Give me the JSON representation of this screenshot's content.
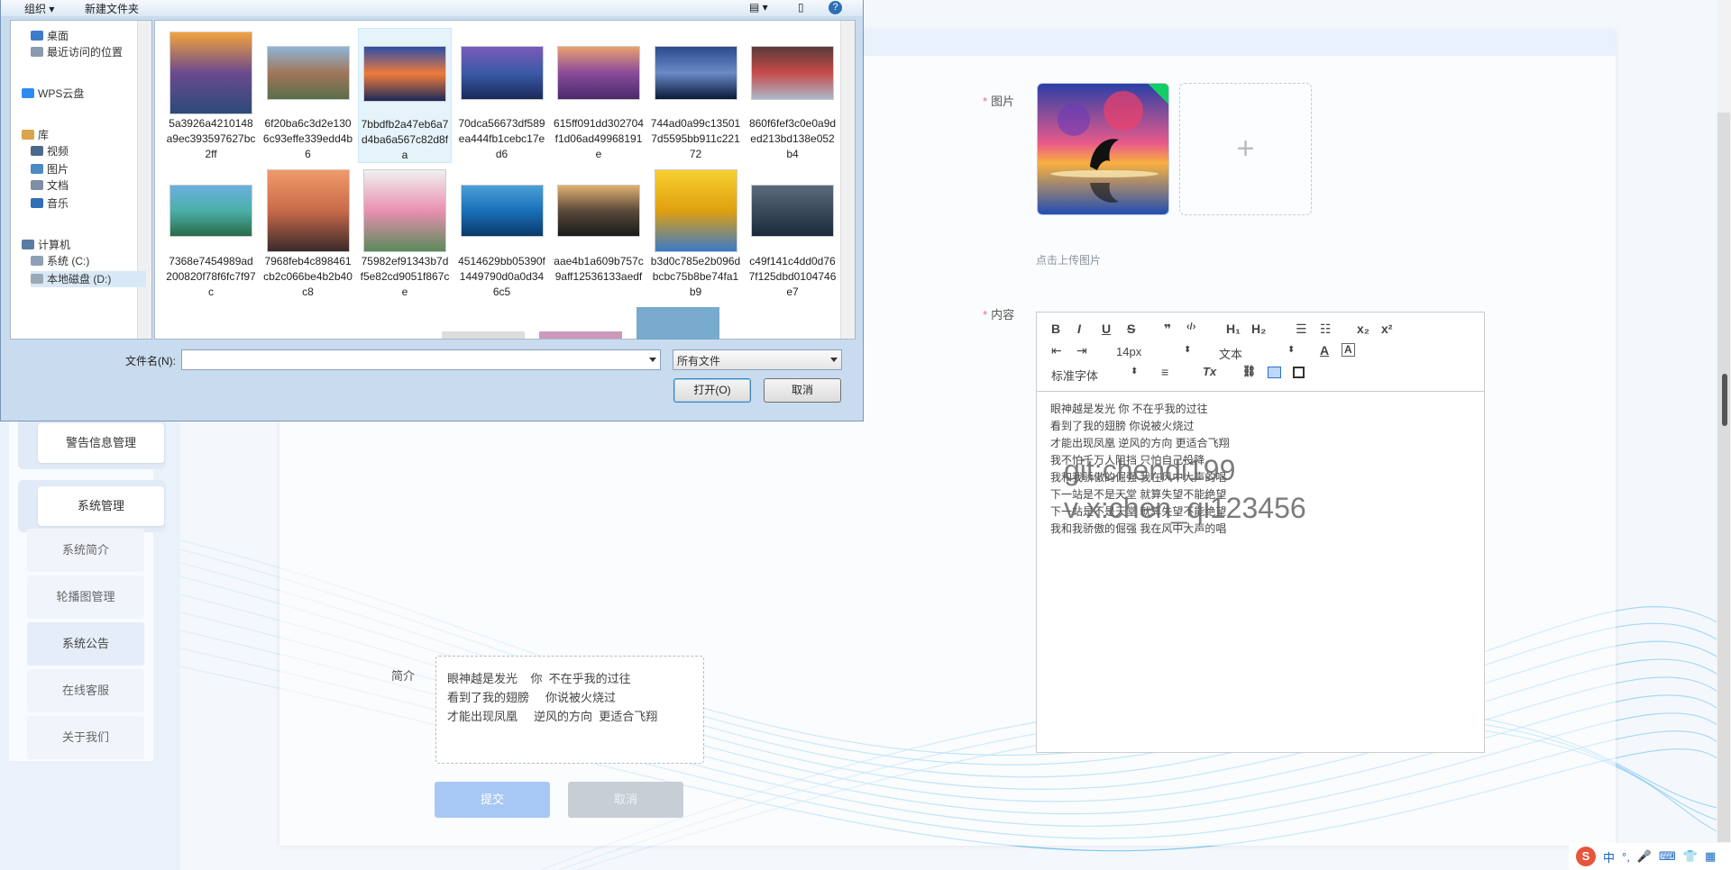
{
  "sidebar": {
    "groups": [
      {
        "label": "警告信息管理"
      },
      {
        "label": "系统管理"
      }
    ],
    "sub_items": [
      {
        "label": "系统简介"
      },
      {
        "label": "轮播图管理"
      },
      {
        "label": "系统公告"
      },
      {
        "label": "在线客服"
      },
      {
        "label": "关于我们"
      }
    ]
  },
  "form": {
    "image_label": "图片",
    "upload_hint": "点击上传图片",
    "upload_plus": "+",
    "content_label": "内容",
    "intro_label": "简介",
    "intro_value": "眼神越是发光    你  不在乎我的过往\n看到了我的翅膀     你说被火烧过\n才能出现凤凰     逆风的方向  更适合飞翔",
    "submit_label": "提交",
    "cancel_label": "取消"
  },
  "editor": {
    "toolbar": {
      "bold": "B",
      "italic": "I",
      "underline": "U",
      "strike": "S",
      "quote": "❞",
      "code": "‹/›",
      "h1": "H₁",
      "h2": "H₂",
      "ordered_list": "☰",
      "bullet_list": "☷",
      "subscript": "x₂",
      "superscript": "x²",
      "font_size": "14px",
      "header_select": "文本",
      "font_family": "标准字体",
      "text_color": "A",
      "bg_color": "A",
      "align": "≡",
      "clean": "Tx",
      "link": "🔗"
    },
    "lines": [
      "眼神越是发光 你 不在乎我的过往",
      "看到了我的翅膀 你说被火烧过",
      "才能出现凤凰 逆风的方向 更适合飞翔",
      "我不怕千万人阻挡 只怕自己投降",
      "我和我骄傲的倔强 我在风中大声的唱",
      "下一站是不是天堂 就算失望不能绝望",
      "下一站是不是天堂 就算失望不能绝望",
      "我和我骄傲的倔强 我在风中大声的唱"
    ],
    "watermark_1": "git:chendi199",
    "watermark_2": "v x:chen_qi123456"
  },
  "dialog": {
    "toolbar": {
      "organize": "组织 ▾",
      "new_folder": "新建文件夹",
      "help": "?"
    },
    "nav_items": [
      {
        "label": "桌面",
        "icon": "desktop-icon",
        "color": "#3d7cc9"
      },
      {
        "label": "最近访问的位置",
        "icon": "recent-icon",
        "color": "#8a9bb0"
      },
      {
        "label": "WPS云盘",
        "icon": "cloud-icon",
        "color": "#2d8cf0"
      },
      {
        "label": "库",
        "icon": "library-icon",
        "color": "#d9a44a"
      },
      {
        "label": "视频",
        "icon": "video-icon",
        "color": "#4b6a8c"
      },
      {
        "label": "图片",
        "icon": "picture-icon",
        "color": "#4b8ac2"
      },
      {
        "label": "文档",
        "icon": "document-icon",
        "color": "#7d8ea5"
      },
      {
        "label": "音乐",
        "icon": "music-icon",
        "color": "#2f6fb5"
      },
      {
        "label": "计算机",
        "icon": "computer-icon",
        "color": "#5a7ba3"
      },
      {
        "label": "系统 (C:)",
        "icon": "drive-icon",
        "color": "#8ea0b5"
      },
      {
        "label": "本地磁盘 (D:)",
        "icon": "drive-icon",
        "color": "#9aa8b8"
      }
    ],
    "files": [
      {
        "name": "5a3926a4210148a9ec393597627bc2ff",
        "colors": [
          "#f2a33b",
          "#6b4a8e",
          "#2c4a7a"
        ],
        "h": 92
      },
      {
        "name": "6f20ba6c3d2e1306c93effe339edd4b6",
        "colors": [
          "#8fb4d8",
          "#a0765a",
          "#5a6e4a"
        ],
        "h": 60
      },
      {
        "name": "7bbdfb2a47eb6a7d4ba6a567c82d8fa",
        "colors": [
          "#2b4ea8",
          "#f07a3a",
          "#1a2a5a"
        ],
        "h": 62
      },
      {
        "name": "70dca56673df589ea444fb1cebc17ed6",
        "colors": [
          "#7a5ab8",
          "#3a5aa8",
          "#1a2a5a"
        ],
        "h": 60
      },
      {
        "name": "615ff091dd302704f1d06ad49968191e",
        "colors": [
          "#e8a070",
          "#8a4a9a",
          "#4a2a6a"
        ],
        "h": 60
      },
      {
        "name": "744ad0a99c135017d5595bb911c22172",
        "colors": [
          "#2a4a8a",
          "#6a8ac8",
          "#0a1a3a"
        ],
        "h": 60
      },
      {
        "name": "860f6fef3c0e0a9ded213bd138e052b4",
        "colors": [
          "#5a3a3a",
          "#c84a4a",
          "#aab8c8"
        ],
        "h": 60
      },
      {
        "name": "7368e7454989ad200820f78f6fc7f97c",
        "colors": [
          "#6ab0e0",
          "#4ab0a8",
          "#2a6a4a"
        ],
        "h": 58
      },
      {
        "name": "7968feb4c898461cb2c066be4b2b40c8",
        "colors": [
          "#f09a6a",
          "#c86a4a",
          "#3a2a2a"
        ],
        "h": 92
      },
      {
        "name": "75982ef91343b7df5e82cd9051f867ce",
        "colors": [
          "#f0f0f0",
          "#e890b0",
          "#5a8a5a"
        ],
        "h": 92
      },
      {
        "name": "4514629bb05390f1449790d0a0d346c5",
        "colors": [
          "#4aa0d8",
          "#1a70b8",
          "#0a3a6a"
        ],
        "h": 58
      },
      {
        "name": "aae4b1a609b757c9aff12536133aedf",
        "colors": [
          "#e0b070",
          "#5a4a3a",
          "#1a1a1a"
        ],
        "h": 58
      },
      {
        "name": "b3d0c785e2b096dbcbc75b8be74fa1b9",
        "colors": [
          "#f8d030",
          "#e0a010",
          "#3a7ac8"
        ],
        "h": 92
      },
      {
        "name": "c49f141c4dd0d767f125dbd0104746e7",
        "colors": [
          "#5a6a7a",
          "#3a4a5a",
          "#1a2a3a"
        ],
        "h": 58
      }
    ],
    "filename_label": "文件名(N):",
    "filename_value": "",
    "filter_value": "所有文件",
    "open_label": "打开(O)",
    "cancel_label": "取消"
  },
  "tray": {
    "items": [
      "S",
      "中",
      "°,",
      "🎤",
      "⌨",
      "👕",
      "▦"
    ]
  }
}
